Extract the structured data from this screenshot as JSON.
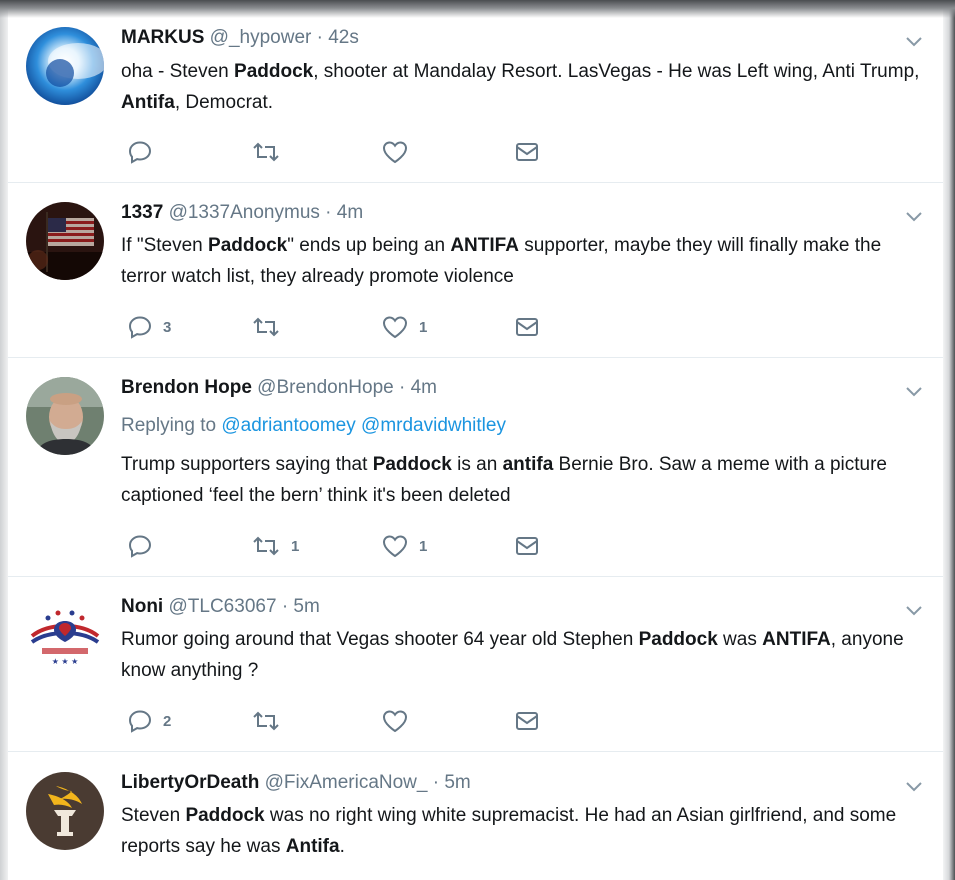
{
  "tweets": [
    {
      "name": "MARKUS",
      "handle": "@_hypower",
      "dot": "·",
      "time": "42s",
      "text_parts": [
        {
          "t": "oha   -   Steven ",
          "b": false
        },
        {
          "t": "Paddock",
          "b": true
        },
        {
          "t": ", shooter at Mandalay Resort. LasVegas - He was Left wing, Anti Trump, ",
          "b": false
        },
        {
          "t": "Antifa",
          "b": true
        },
        {
          "t": ", Democrat.",
          "b": false
        }
      ],
      "replies": "",
      "retweets": "",
      "likes": ""
    },
    {
      "name": "1337",
      "handle": "@1337Anonymus",
      "dot": "·",
      "time": "4m",
      "text_parts": [
        {
          "t": "If \"Steven ",
          "b": false
        },
        {
          "t": "Paddock",
          "b": true
        },
        {
          "t": "\" ends up being an ",
          "b": false
        },
        {
          "t": "ANTIFA",
          "b": true
        },
        {
          "t": " supporter, maybe they will finally make the terror watch list, they already promote violence",
          "b": false
        }
      ],
      "replies": "3",
      "retweets": "",
      "likes": "1"
    },
    {
      "name": "Brendon Hope",
      "handle": "@BrendonHope",
      "dot": "·",
      "time": "4m",
      "replying_label": "Replying to",
      "replying_mentions": "@adriantoomey @mrdavidwhitley",
      "text_parts": [
        {
          "t": "Trump supporters saying that ",
          "b": false
        },
        {
          "t": "Paddock",
          "b": true
        },
        {
          "t": " is an ",
          "b": false
        },
        {
          "t": "antifa",
          "b": true
        },
        {
          "t": " Bernie Bro. Saw a meme with a picture captioned ‘feel the bern’ think it's been deleted",
          "b": false
        }
      ],
      "replies": "",
      "retweets": "1",
      "likes": "1"
    },
    {
      "name": "Noni",
      "handle": "@TLC63067",
      "dot": "·",
      "time": "5m",
      "text_parts": [
        {
          "t": "Rumor going around that Vegas shooter 64 year old Stephen ",
          "b": false
        },
        {
          "t": "Paddock",
          "b": true
        },
        {
          "t": " was ",
          "b": false
        },
        {
          "t": "ANTIFA",
          "b": true
        },
        {
          "t": ", anyone know anything ?",
          "b": false
        }
      ],
      "replies": "2",
      "retweets": "",
      "likes": ""
    },
    {
      "name": "LibertyOrDeath",
      "handle": "@FixAmericaNow_",
      "dot": "·",
      "time": "5m",
      "text_parts": [
        {
          "t": "Steven ",
          "b": false
        },
        {
          "t": "Paddock",
          "b": true
        },
        {
          "t": " was no right wing white supremacist. He had an Asian girlfriend, and some reports say he was ",
          "b": false
        },
        {
          "t": "Antifa",
          "b": true
        },
        {
          "t": ".",
          "b": false
        }
      ],
      "replies": "",
      "retweets": "",
      "likes": ""
    }
  ],
  "icons": {
    "reply": "reply-icon",
    "retweet": "retweet-icon",
    "like": "heart-icon",
    "dm": "envelope-icon",
    "caret": "chevron-down-icon"
  },
  "colors": {
    "text": "#14171a",
    "secondary": "#657786",
    "link": "#1b95e0",
    "divider": "#e6ecf0"
  }
}
